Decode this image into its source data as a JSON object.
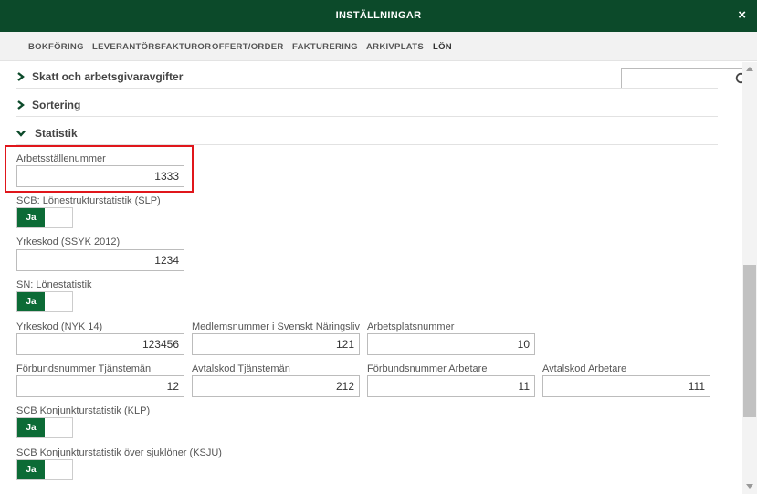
{
  "window": {
    "title": "INSTÄLLNINGAR",
    "close_label": "×"
  },
  "tabs": [
    {
      "label": "BOKFÖRING"
    },
    {
      "label": "LEVERANTÖRSFAKTUROR"
    },
    {
      "label": "OFFERT/ORDER"
    },
    {
      "label": "FAKTURERING"
    },
    {
      "label": "ARKIVPLATS"
    },
    {
      "label": "LÖN",
      "active": true
    }
  ],
  "search": {
    "value": "",
    "placeholder": "",
    "icon": "search-icon"
  },
  "sections": [
    {
      "label": "Skatt och arbetsgivaravgifter",
      "expanded": false
    },
    {
      "label": "Sortering",
      "expanded": false
    },
    {
      "label": "Statistik",
      "expanded": true
    }
  ],
  "statistik": {
    "arbetsstallenummer": {
      "label": "Arbetsställenummer",
      "value": "1333"
    },
    "slp": {
      "label": "SCB: Lönestrukturstatistik (SLP)",
      "toggle": "Ja"
    },
    "ssyk": {
      "label": "Yrkeskod (SSYK 2012)",
      "value": "1234"
    },
    "sn": {
      "label": "SN: Lönestatistik",
      "toggle": "Ja"
    },
    "nyk": {
      "label": "Yrkeskod (NYK 14)",
      "value": "123456"
    },
    "medlemsnummer": {
      "label": "Medlemsnummer i Svenskt Näringsliv",
      "value": "121"
    },
    "arbetsplatsnummer": {
      "label": "Arbetsplatsnummer",
      "value": "10"
    },
    "forbund_tjm": {
      "label": "Förbundsnummer Tjänstemän",
      "value": "12"
    },
    "avtal_tjm": {
      "label": "Avtalskod Tjänstemän",
      "value": "212"
    },
    "forbund_arb": {
      "label": "Förbundsnummer Arbetare",
      "value": "11"
    },
    "avtal_arb": {
      "label": "Avtalskod Arbetare",
      "value": "111"
    },
    "klp": {
      "label": "SCB Konjunkturstatistik (KLP)",
      "toggle": "Ja"
    },
    "ksju": {
      "label": "SCB Konjunkturstatistik över sjuklöner (KSJU)",
      "toggle": "Ja"
    }
  },
  "colors": {
    "header": "#0c4a2a",
    "toggle_on": "#0c6b36",
    "highlight": "#e0161b"
  }
}
